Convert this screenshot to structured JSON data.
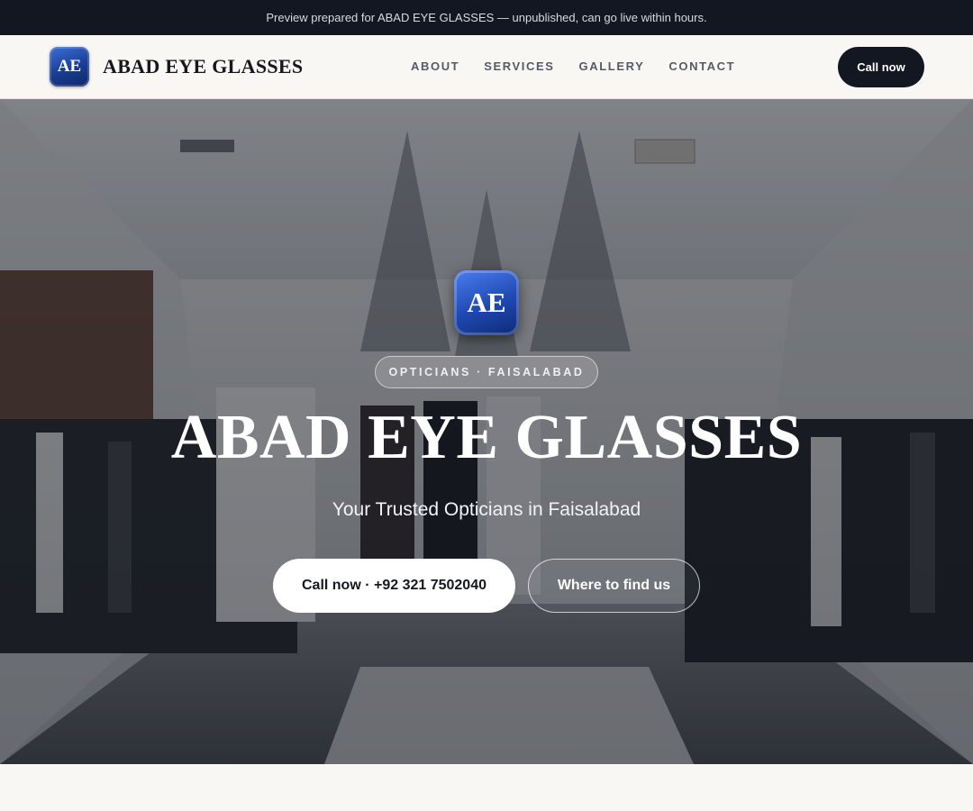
{
  "banner": {
    "text": "Preview prepared for ABAD EYE GLASSES — unpublished, can go live within hours."
  },
  "header": {
    "logo_initials": "AE",
    "brand_name": "ABAD EYE GLASSES",
    "nav_links": [
      "ABOUT",
      "SERVICES",
      "GALLERY",
      "CONTACT"
    ],
    "call_label": "Call now"
  },
  "hero": {
    "logo_initials": "AE",
    "tagline_pill": "OPTICIANS · FAISALABAD",
    "title": "ABAD EYE GLASSES",
    "subtitle": "Your Trusted Opticians in Faisalabad",
    "primary_button": "Call now · +92 321 7502040",
    "secondary_button": "Where to find us",
    "background_image": "shop-interior-photo"
  },
  "colors": {
    "banner_bg": "#131722",
    "nav_bg": "#f8f7f4",
    "call_button_bg": "#131722",
    "logo_blue": "#1e48b0",
    "hero_text": "#ffffff"
  }
}
